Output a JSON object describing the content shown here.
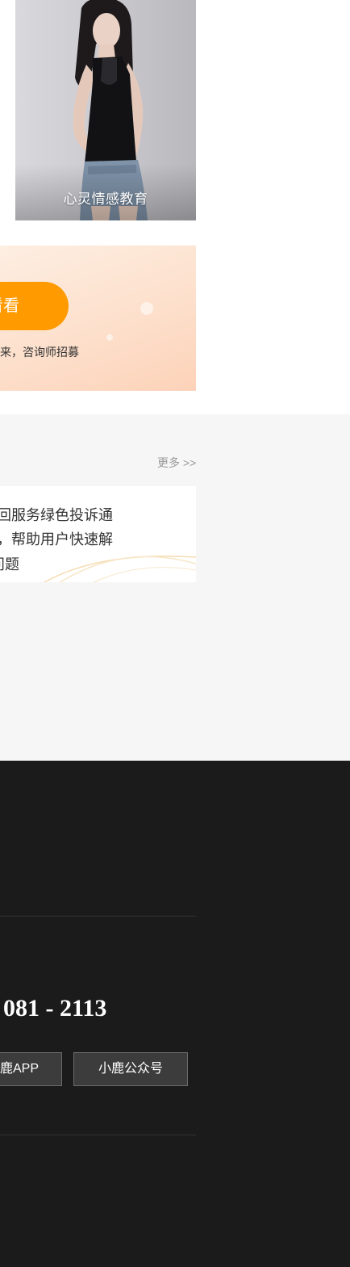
{
  "photo_card": {
    "caption": "心灵情感教育"
  },
  "promo": {
    "button_label": "看看",
    "subtitle": "来，咨询师招募"
  },
  "news": {
    "more_label": "更多 >>",
    "lines": [
      "回服务绿色投诉通",
      "，帮助用户快速解",
      "问题"
    ]
  },
  "footer": {
    "phone": "081 - 2113",
    "app_button_label": "鹿APP",
    "wechat_button_label": "小鹿公众号"
  },
  "colors": {
    "accent_orange": "#ff9a00",
    "footer_bg": "#1b1b1b",
    "section_gray": "#f6f6f6"
  }
}
